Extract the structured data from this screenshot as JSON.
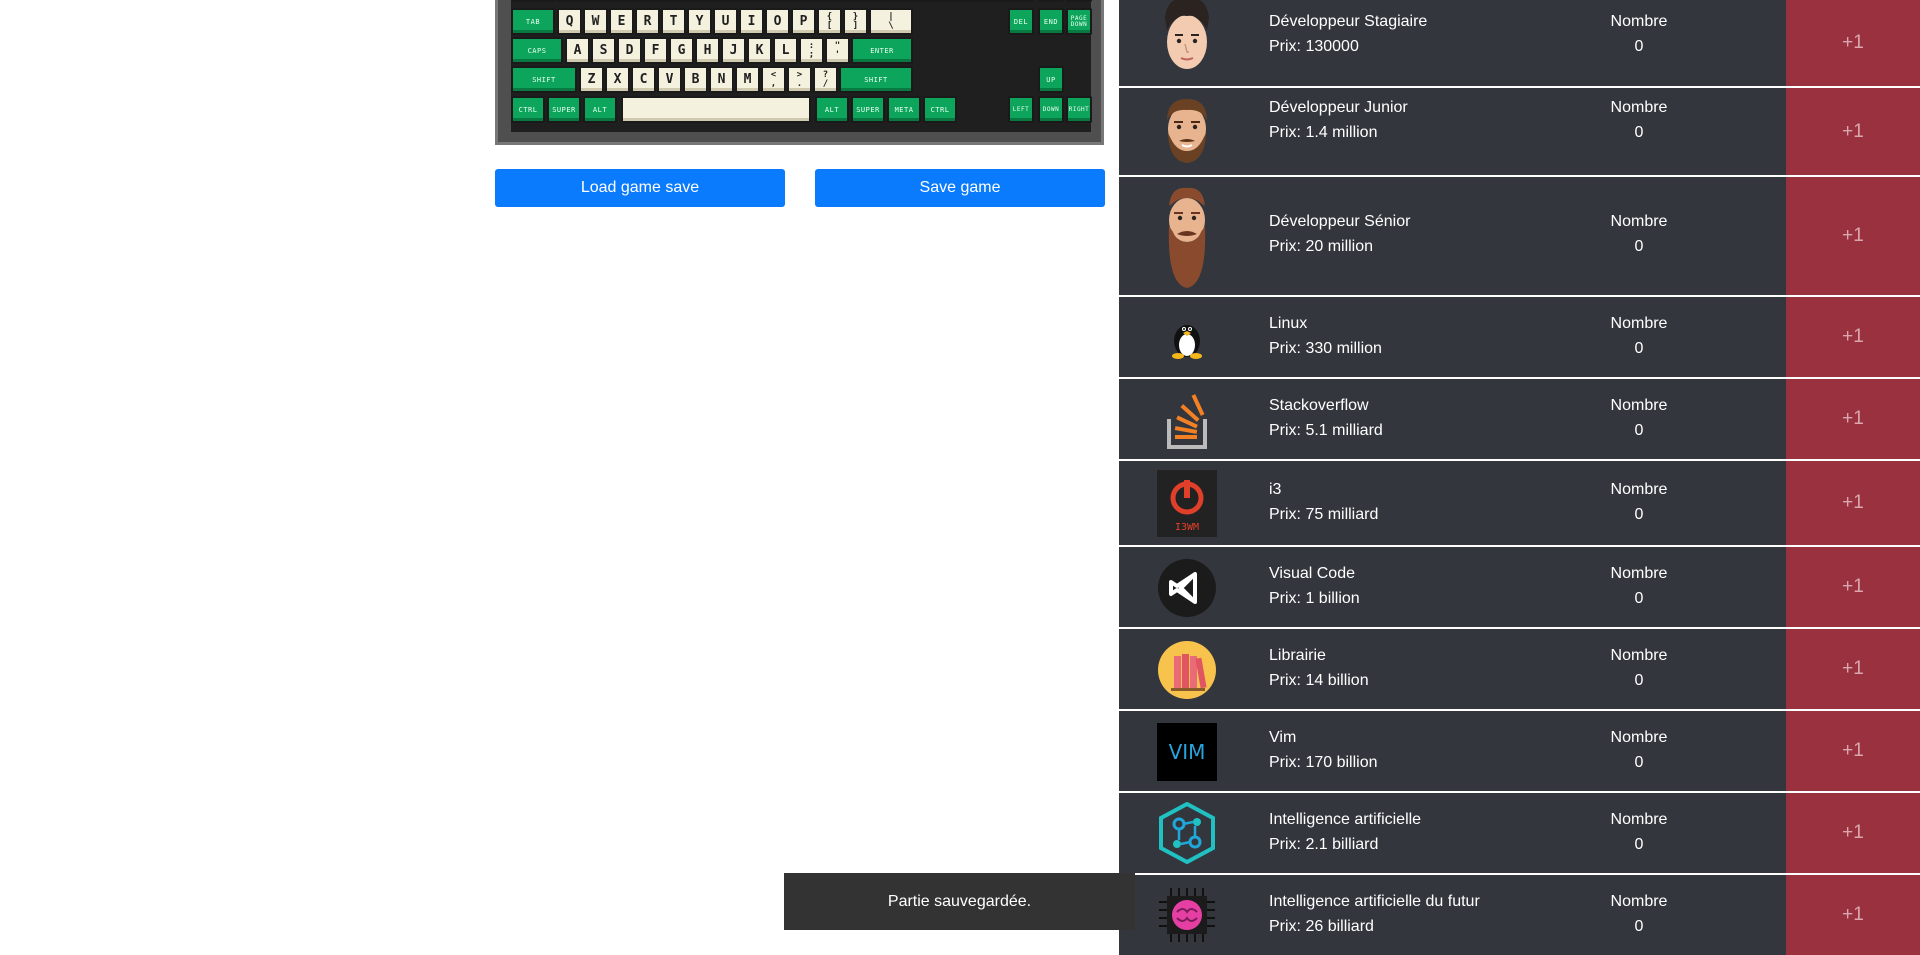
{
  "keyboard": {
    "row_tab": [
      "TAB",
      "Q",
      "W",
      "E",
      "R",
      "T",
      "Y",
      "U",
      "I",
      "O",
      "P",
      "{\n[",
      "}\n]",
      "|\n\\"
    ],
    "row_caps": [
      "CAPS",
      "A",
      "S",
      "D",
      "F",
      "G",
      "H",
      "J",
      "K",
      "L",
      ":\n;",
      "\"\n'",
      "ENTER"
    ],
    "row_shift": [
      "SHIFT",
      "Z",
      "X",
      "C",
      "V",
      "B",
      "N",
      "M",
      "<\n,",
      ">\n.",
      "?\n/",
      "SHIFT"
    ],
    "row_ctrl": [
      "CTRL",
      "SUPER",
      "ALT",
      "",
      "ALT",
      "SUPER",
      "META",
      "CTRL"
    ],
    "nav_top": [
      "DEL",
      "END",
      "PAGE\nDOWN"
    ],
    "arrows": [
      "UP",
      "LEFT",
      "DOWN",
      "RIGHT"
    ]
  },
  "buttons": {
    "load": "Load game save",
    "save": "Save game"
  },
  "store": {
    "count_label": "Nombre",
    "buy_label": "+1",
    "items": [
      {
        "name": "Développeur Stagiaire",
        "price": "Prix: 130000",
        "count": "0",
        "icon": "intern-face-icon"
      },
      {
        "name": "Développeur Junior",
        "price": "Prix: 1.4 million",
        "count": "0",
        "icon": "junior-face-icon"
      },
      {
        "name": "Développeur Sénior",
        "price": "Prix: 20 million",
        "count": "0",
        "icon": "senior-face-icon"
      },
      {
        "name": "Linux",
        "price": "Prix: 330 million",
        "count": "0",
        "icon": "tux-penguin-icon"
      },
      {
        "name": "Stackoverflow",
        "price": "Prix: 5.1 milliard",
        "count": "0",
        "icon": "stackoverflow-icon"
      },
      {
        "name": "i3",
        "price": "Prix: 75 milliard",
        "count": "0",
        "icon": "i3wm-icon",
        "icon_text": "I3WM"
      },
      {
        "name": "Visual Code",
        "price": "Prix: 1 billion",
        "count": "0",
        "icon": "vscode-icon"
      },
      {
        "name": "Librairie",
        "price": "Prix: 14 billion",
        "count": "0",
        "icon": "books-icon"
      },
      {
        "name": "Vim",
        "price": "Prix: 170 billion",
        "count": "0",
        "icon": "vim-icon",
        "icon_text": "VIM"
      },
      {
        "name": "Intelligence artificielle",
        "price": "Prix: 2.1 billiard",
        "count": "0",
        "icon": "ai-network-icon"
      },
      {
        "name": "Intelligence artificielle du futur",
        "price": "Prix: 26 billiard",
        "count": "0",
        "icon": "ai-brain-chip-icon"
      }
    ]
  },
  "toast": {
    "message": "Partie sauvegardée."
  },
  "colors": {
    "row_bg": "#33373d",
    "buy_bg": "#9a313f",
    "button_bg": "#0b7bfd",
    "key_green": "#0da55b",
    "key_light": "#f4f1de"
  }
}
